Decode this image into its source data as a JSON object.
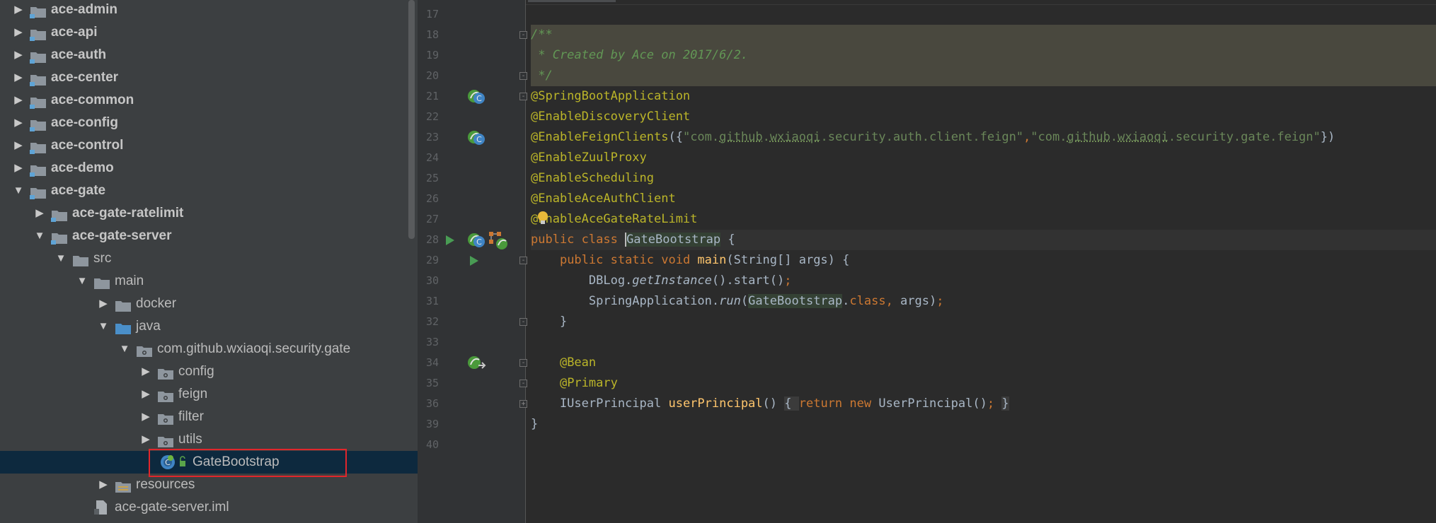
{
  "project_tree": {
    "items": [
      {
        "label": "ace-admin",
        "expanded": false,
        "kind": "module-folder",
        "depth": 0
      },
      {
        "label": "ace-api",
        "expanded": false,
        "kind": "module-folder",
        "depth": 0
      },
      {
        "label": "ace-auth",
        "expanded": false,
        "kind": "module-folder",
        "depth": 0
      },
      {
        "label": "ace-center",
        "expanded": false,
        "kind": "module-folder",
        "depth": 0
      },
      {
        "label": "ace-common",
        "expanded": false,
        "kind": "module-folder",
        "depth": 0
      },
      {
        "label": "ace-config",
        "expanded": false,
        "kind": "module-folder",
        "depth": 0
      },
      {
        "label": "ace-control",
        "expanded": false,
        "kind": "module-folder",
        "depth": 0
      },
      {
        "label": "ace-demo",
        "expanded": false,
        "kind": "module-folder",
        "depth": 0
      },
      {
        "label": "ace-gate",
        "expanded": true,
        "kind": "module-folder",
        "depth": 0
      },
      {
        "label": "ace-gate-ratelimit",
        "expanded": false,
        "kind": "module-folder",
        "depth": 1
      },
      {
        "label": "ace-gate-server",
        "expanded": true,
        "kind": "module-folder",
        "depth": 1
      },
      {
        "label": "src",
        "expanded": true,
        "kind": "folder",
        "depth": 2
      },
      {
        "label": "main",
        "expanded": true,
        "kind": "folder",
        "depth": 3
      },
      {
        "label": "docker",
        "expanded": false,
        "kind": "folder",
        "depth": 4
      },
      {
        "label": "java",
        "expanded": true,
        "kind": "source-folder",
        "depth": 4
      },
      {
        "label": "com.github.wxiaoqi.security.gate",
        "expanded": true,
        "kind": "package",
        "depth": 5
      },
      {
        "label": "config",
        "expanded": false,
        "kind": "package",
        "depth": 6
      },
      {
        "label": "feign",
        "expanded": false,
        "kind": "package",
        "depth": 6
      },
      {
        "label": "filter",
        "expanded": false,
        "kind": "package",
        "depth": 6
      },
      {
        "label": "utils",
        "expanded": false,
        "kind": "package",
        "depth": 6
      },
      {
        "label": "GateBootstrap",
        "expanded": null,
        "kind": "spring-boot-class",
        "depth": 6,
        "selected": true
      },
      {
        "label": "resources",
        "expanded": false,
        "kind": "resources-folder",
        "depth": 4
      },
      {
        "label": "ace-gate-server.iml",
        "expanded": null,
        "kind": "iml-file",
        "depth": 3
      }
    ]
  },
  "editor": {
    "lines": [
      {
        "n": "17",
        "tokens": []
      },
      {
        "n": "18",
        "style": "doc",
        "tokens": [
          {
            "t": "/**",
            "c": "doc"
          }
        ]
      },
      {
        "n": "19",
        "style": "doc",
        "tokens": [
          {
            "t": " * Created by Ace on 2017/6/2.",
            "c": "doc"
          }
        ]
      },
      {
        "n": "20",
        "style": "doc",
        "tokens": [
          {
            "t": " */",
            "c": "doc"
          }
        ]
      },
      {
        "n": "21",
        "tokens": [
          {
            "t": "@SpringBootApplication",
            "c": "ann"
          }
        ]
      },
      {
        "n": "22",
        "tokens": [
          {
            "t": "@EnableDiscoveryClient",
            "c": "ann"
          }
        ]
      },
      {
        "n": "23",
        "tokens": [
          {
            "t": "@EnableFeignClients",
            "c": "ann"
          },
          {
            "t": "({",
            "c": ""
          },
          {
            "t": "\"com.",
            "c": "str"
          },
          {
            "t": "github",
            "c": "str u"
          },
          {
            "t": ".",
            "c": "str"
          },
          {
            "t": "wxiaoqi",
            "c": "str u"
          },
          {
            "t": ".security.auth.client.feign\"",
            "c": "str"
          },
          {
            "t": ",",
            "c": "kw"
          },
          {
            "t": "\"com.",
            "c": "str"
          },
          {
            "t": "github",
            "c": "str u"
          },
          {
            "t": ".",
            "c": "str"
          },
          {
            "t": "wxiaoqi",
            "c": "str u"
          },
          {
            "t": ".security.gate.feign\"",
            "c": "str"
          },
          {
            "t": "})",
            "c": ""
          }
        ]
      },
      {
        "n": "24",
        "tokens": [
          {
            "t": "@EnableZuulProxy",
            "c": "ann"
          }
        ]
      },
      {
        "n": "25",
        "tokens": [
          {
            "t": "@EnableScheduling",
            "c": "ann"
          }
        ]
      },
      {
        "n": "26",
        "tokens": [
          {
            "t": "@EnableAceAuthClient",
            "c": "ann"
          }
        ]
      },
      {
        "n": "27",
        "tokens": [
          {
            "t": "@EnableAceGateRateLimit",
            "c": "ann"
          }
        ]
      },
      {
        "n": "28",
        "style": "current",
        "tokens": [
          {
            "t": "public class ",
            "c": "kw"
          },
          {
            "t": "GateBootstrap",
            "c": "usage caret"
          },
          {
            "t": " {",
            "c": ""
          }
        ]
      },
      {
        "n": "29",
        "tokens": [
          {
            "t": "    ",
            "c": ""
          },
          {
            "t": "public static void ",
            "c": "kw"
          },
          {
            "t": "main",
            "c": "mth"
          },
          {
            "t": "(String[] args) {",
            "c": ""
          }
        ]
      },
      {
        "n": "30",
        "tokens": [
          {
            "t": "        DBLog.",
            "c": ""
          },
          {
            "t": "getInstance",
            "c": "ital"
          },
          {
            "t": "().start()",
            "c": ""
          },
          {
            "t": ";",
            "c": "kw"
          }
        ]
      },
      {
        "n": "31",
        "tokens": [
          {
            "t": "        SpringApplication.",
            "c": ""
          },
          {
            "t": "run",
            "c": "ital"
          },
          {
            "t": "(",
            "c": ""
          },
          {
            "t": "GateBootstrap",
            "c": "usage"
          },
          {
            "t": ".",
            "c": ""
          },
          {
            "t": "class, ",
            "c": "kw"
          },
          {
            "t": "args)",
            "c": ""
          },
          {
            "t": ";",
            "c": "kw"
          }
        ]
      },
      {
        "n": "32",
        "tokens": [
          {
            "t": "    }",
            "c": ""
          }
        ]
      },
      {
        "n": "33",
        "tokens": []
      },
      {
        "n": "34",
        "tokens": [
          {
            "t": "    ",
            "c": ""
          },
          {
            "t": "@Bean",
            "c": "ann"
          }
        ]
      },
      {
        "n": "35",
        "tokens": [
          {
            "t": "    ",
            "c": ""
          },
          {
            "t": "@Primary",
            "c": "ann"
          }
        ]
      },
      {
        "n": "36",
        "tokens": [
          {
            "t": "    IUserPrincipal ",
            "c": ""
          },
          {
            "t": "userPrincipal",
            "c": "mth"
          },
          {
            "t": "() ",
            "c": ""
          },
          {
            "t": "{ ",
            "c": "bracebg"
          },
          {
            "t": "return new ",
            "c": "kw"
          },
          {
            "t": "UserPrincipal()",
            "c": ""
          },
          {
            "t": "; ",
            "c": "kw"
          },
          {
            "t": "}",
            "c": "bracebg"
          }
        ]
      },
      {
        "n": "39",
        "tokens": [
          {
            "t": "}",
            "c": ""
          }
        ]
      },
      {
        "n": "40",
        "tokens": []
      }
    ],
    "gutter_icons": [
      {
        "line": "21",
        "icon": "spring-bean-class-icon"
      },
      {
        "line": "23",
        "icon": "spring-bean-class-icon"
      },
      {
        "line": "28",
        "icon": "run-gutter-icon"
      },
      {
        "line": "28",
        "icon": "spring-bean-class-icon"
      },
      {
        "line": "28",
        "icon": "spring-boot-config-icon"
      },
      {
        "line": "29",
        "icon": "run-gutter-icon"
      },
      {
        "line": "34",
        "icon": "spring-bean-navigate-icon"
      },
      {
        "line": "27",
        "icon": "intention-bulb-icon"
      }
    ]
  },
  "colors": {
    "tree_bg": "#3c3f41",
    "editor_bg": "#2b2b2b",
    "gutter_bg": "#313335",
    "selection_bg": "#0d293e",
    "highlight_box": "#e0262b",
    "annotation": "#bbb529",
    "keyword": "#cc7832",
    "string": "#6a8759",
    "method": "#ffc66d",
    "doc_comment": "#629755"
  }
}
